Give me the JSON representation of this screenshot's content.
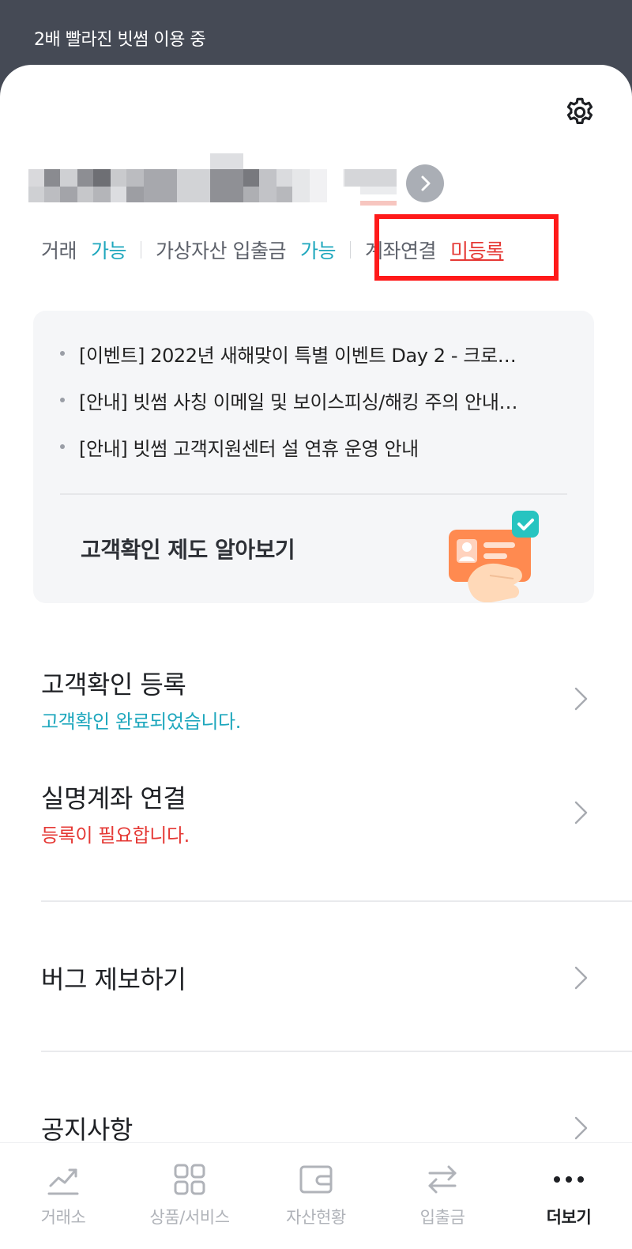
{
  "status_bar": {
    "text": "2배 빨라진 빗썸 이용 중"
  },
  "header": {
    "settings_icon": "gear-icon"
  },
  "profile": {
    "arrow_icon": "chevron-right-icon"
  },
  "account_status": {
    "trade_label": "거래",
    "trade_value": "가능",
    "crypto_label": "가상자산 입출금",
    "crypto_value": "가능",
    "bank_label": "계좌연결",
    "bank_value": "미등록"
  },
  "notices": [
    {
      "text": "[이벤트] 2022년 새해맞이 특별 이벤트 Day 2 - 크로…"
    },
    {
      "text": "[안내] 빗썸 사칭 이메일 및 보이스피싱/해킹 주의 안내…"
    },
    {
      "text": "[안내] 빗썸 고객지원센터 설 연휴 운영 안내"
    }
  ],
  "kyc_banner": {
    "title": "고객확인 제도 알아보기"
  },
  "menu": {
    "kyc_register": {
      "title": "고객확인 등록",
      "subtitle": "고객확인 완료되었습니다."
    },
    "bank_link": {
      "title": "실명계좌 연결",
      "subtitle": "등록이 필요합니다."
    },
    "bug_report": {
      "title": "버그 제보하기"
    },
    "notice": {
      "title": "공지사항"
    }
  },
  "tabs": [
    {
      "label": "거래소",
      "icon": "trend-chart-icon"
    },
    {
      "label": "상품/서비스",
      "icon": "grid-icon"
    },
    {
      "label": "자산현황",
      "icon": "wallet-icon"
    },
    {
      "label": "입출금",
      "icon": "transfer-arrows-icon"
    },
    {
      "label": "더보기",
      "icon": "more-dots-icon",
      "active": true
    }
  ],
  "colors": {
    "accent_teal": "#1ea7bd",
    "alert_red": "#e53935",
    "highlight_box": "#ff1a1a",
    "status_bar_bg": "#454a55"
  }
}
